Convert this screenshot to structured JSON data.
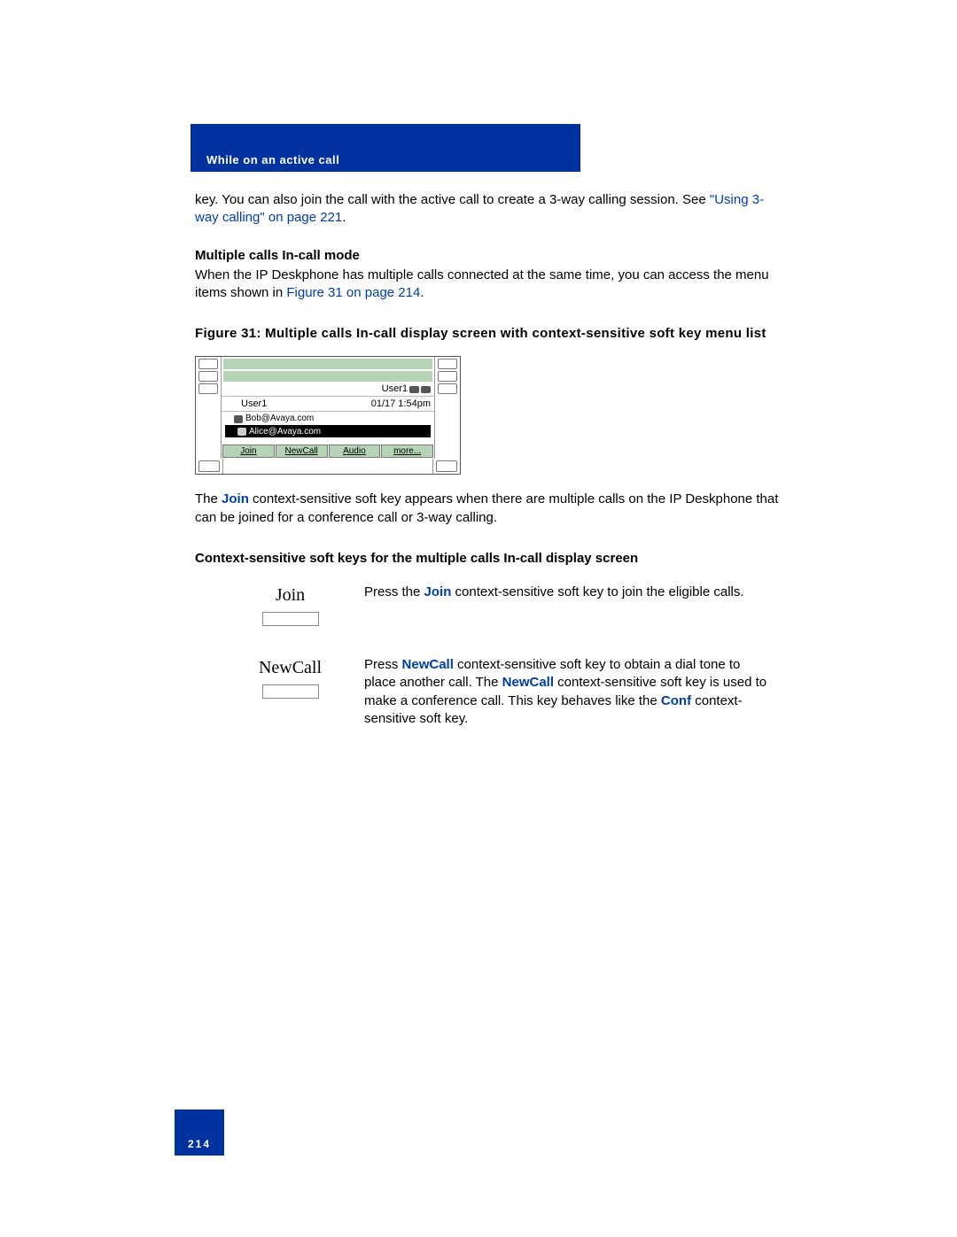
{
  "header": {
    "title": "While on an active call"
  },
  "intro": {
    "part1": "key. You can also join the call with the active call to create a 3-way calling session. See ",
    "link": "\"Using 3-way calling\" on page 221",
    "part2": "."
  },
  "section1": {
    "heading": "Multiple calls In-call mode",
    "body_part1": "When the IP Deskphone has multiple calls connected at the same time, you can access the menu items shown in ",
    "body_link": "Figure 31 on page 214",
    "body_part2": "."
  },
  "figure": {
    "caption": "Figure 31: Multiple calls In-call display screen with context-sensitive soft key menu list",
    "status_user": "User1",
    "title_user": "User1",
    "title_time": "01/17 1:54pm",
    "call1": "Bob@Avaya.com",
    "call2": "Alice@Avaya.com",
    "sk1": "Join",
    "sk2": "NewCall",
    "sk3": "Audio",
    "sk4": "more..."
  },
  "after_figure": {
    "p1a": "The ",
    "p1b": "Join",
    "p1c": " context-sensitive soft key appears when there are multiple calls on the IP Deskphone that can be joined for a conference call or 3-way calling.",
    "heading2": "Context-sensitive soft keys for the multiple calls In-call display screen"
  },
  "softkeys": [
    {
      "label": "Join",
      "desc_parts": [
        {
          "t": "Press the "
        },
        {
          "t": "Join",
          "cls": "link bold"
        },
        {
          "t": " context-sensitive soft key to join the eligible calls."
        }
      ]
    },
    {
      "label": "NewCall",
      "desc_parts": [
        {
          "t": "Press "
        },
        {
          "t": "NewCall",
          "cls": "link bold"
        },
        {
          "t": " context-sensitive soft key to obtain a dial tone to place another call. The "
        },
        {
          "t": "NewCall",
          "cls": "link bold"
        },
        {
          "t": " context-sensitive soft key is used to make a conference call. This key behaves like the "
        },
        {
          "t": "Conf",
          "cls": "link bold"
        },
        {
          "t": " context-sensitive soft key."
        }
      ]
    }
  ],
  "footer": {
    "page": "214"
  }
}
